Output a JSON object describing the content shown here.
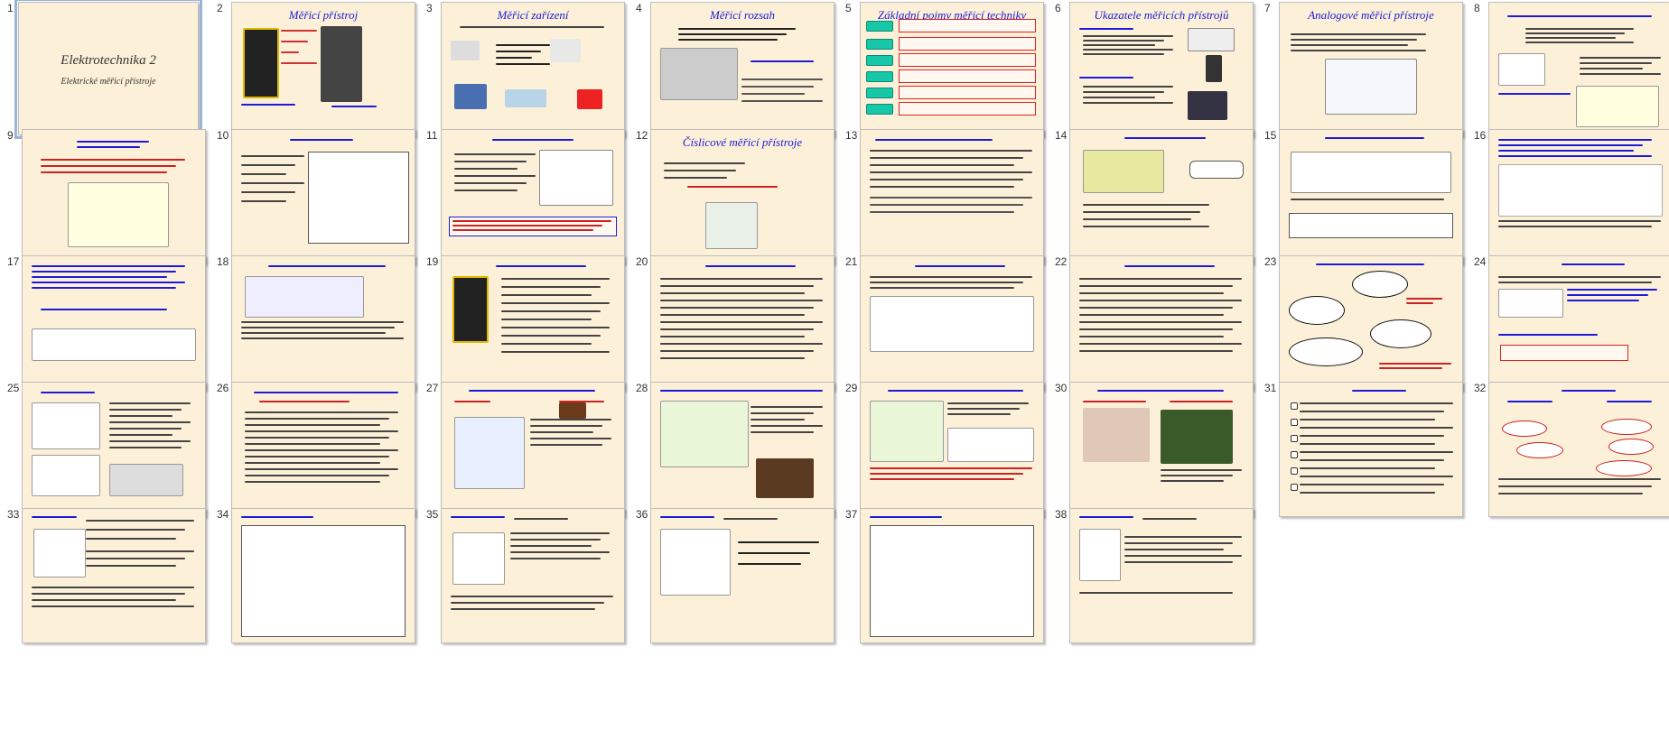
{
  "slides": [
    {
      "num": "1",
      "title": "Elektrotechnika 2",
      "subtitle": "Elektrické měřicí přístroje",
      "selected": true
    },
    {
      "num": "2",
      "title": "Měřicí přístroj"
    },
    {
      "num": "3",
      "title": "Měřicí zařízení"
    },
    {
      "num": "4",
      "title": "Měřicí rozsah"
    },
    {
      "num": "5",
      "title": "Základní pojmy měřicí techniky"
    },
    {
      "num": "6",
      "title": "Ukazatele měřicích přístrojů"
    },
    {
      "num": "7",
      "title": "Analogové měřicí přístroje"
    },
    {
      "num": "8",
      "title": ""
    },
    {
      "num": "9",
      "title": ""
    },
    {
      "num": "10",
      "title": ""
    },
    {
      "num": "11",
      "title": ""
    },
    {
      "num": "12",
      "title": "Číslicové měřicí přístroje"
    },
    {
      "num": "13",
      "title": ""
    },
    {
      "num": "14",
      "title": ""
    },
    {
      "num": "15",
      "title": ""
    },
    {
      "num": "16",
      "title": ""
    },
    {
      "num": "17",
      "title": ""
    },
    {
      "num": "18",
      "title": ""
    },
    {
      "num": "19",
      "title": ""
    },
    {
      "num": "20",
      "title": ""
    },
    {
      "num": "21",
      "title": ""
    },
    {
      "num": "22",
      "title": ""
    },
    {
      "num": "23",
      "title": ""
    },
    {
      "num": "24",
      "title": ""
    },
    {
      "num": "25",
      "title": ""
    },
    {
      "num": "26",
      "title": ""
    },
    {
      "num": "27",
      "title": ""
    },
    {
      "num": "28",
      "title": ""
    },
    {
      "num": "29",
      "title": ""
    },
    {
      "num": "30",
      "title": ""
    },
    {
      "num": "31",
      "title": ""
    },
    {
      "num": "32",
      "title": ""
    },
    {
      "num": "33",
      "title": ""
    },
    {
      "num": "34",
      "title": ""
    },
    {
      "num": "35",
      "title": ""
    },
    {
      "num": "36",
      "title": ""
    },
    {
      "num": "37",
      "title": ""
    },
    {
      "num": "38",
      "title": ""
    }
  ],
  "colors": {
    "slide_bg": "#fdf0d8",
    "title_blue": "#1c1cd8",
    "accent_red": "#d22222",
    "accent_green": "#16c8a8",
    "selection": "#9bb4d6"
  }
}
